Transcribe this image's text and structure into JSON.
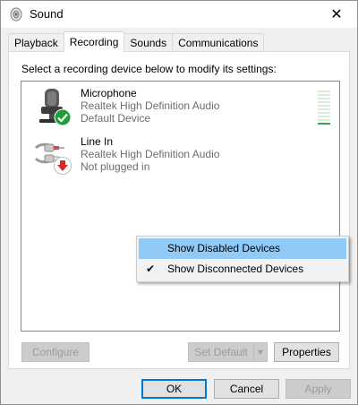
{
  "window": {
    "title": "Sound",
    "close_glyph": "✕"
  },
  "tabs": [
    {
      "label": "Playback",
      "active": false
    },
    {
      "label": "Recording",
      "active": true
    },
    {
      "label": "Sounds",
      "active": false
    },
    {
      "label": "Communications",
      "active": false
    }
  ],
  "panel": {
    "instruction": "Select a recording device below to modify its settings:"
  },
  "devices": [
    {
      "name": "Microphone",
      "driver": "Realtek High Definition Audio",
      "state": "Default Device",
      "icon": "microphone-icon",
      "badge": "green-check-icon",
      "level": 0.05
    },
    {
      "name": "Line In",
      "driver": "Realtek High Definition Audio",
      "state": "Not plugged in",
      "icon": "line-in-cable-icon",
      "badge": "red-down-arrow-icon"
    }
  ],
  "context_menu": {
    "items": [
      {
        "label": "Show Disabled Devices",
        "checked": false,
        "highlighted": true
      },
      {
        "label": "Show Disconnected Devices",
        "checked": true,
        "highlighted": false
      }
    ],
    "check_glyph": "✔"
  },
  "panel_buttons": {
    "configure": "Configure",
    "set_default": "Set Default",
    "set_default_arrow": "▼",
    "properties": "Properties"
  },
  "dialog_buttons": {
    "ok": "OK",
    "cancel": "Cancel",
    "apply": "Apply"
  },
  "colors": {
    "highlight": "#91c9f7",
    "default_button_border": "#0078d7",
    "level_active": "#2da84a",
    "level_inactive": "#d8ead8",
    "check_badge": "#1e9e3a",
    "unplugged_badge": "#d12b2b"
  }
}
